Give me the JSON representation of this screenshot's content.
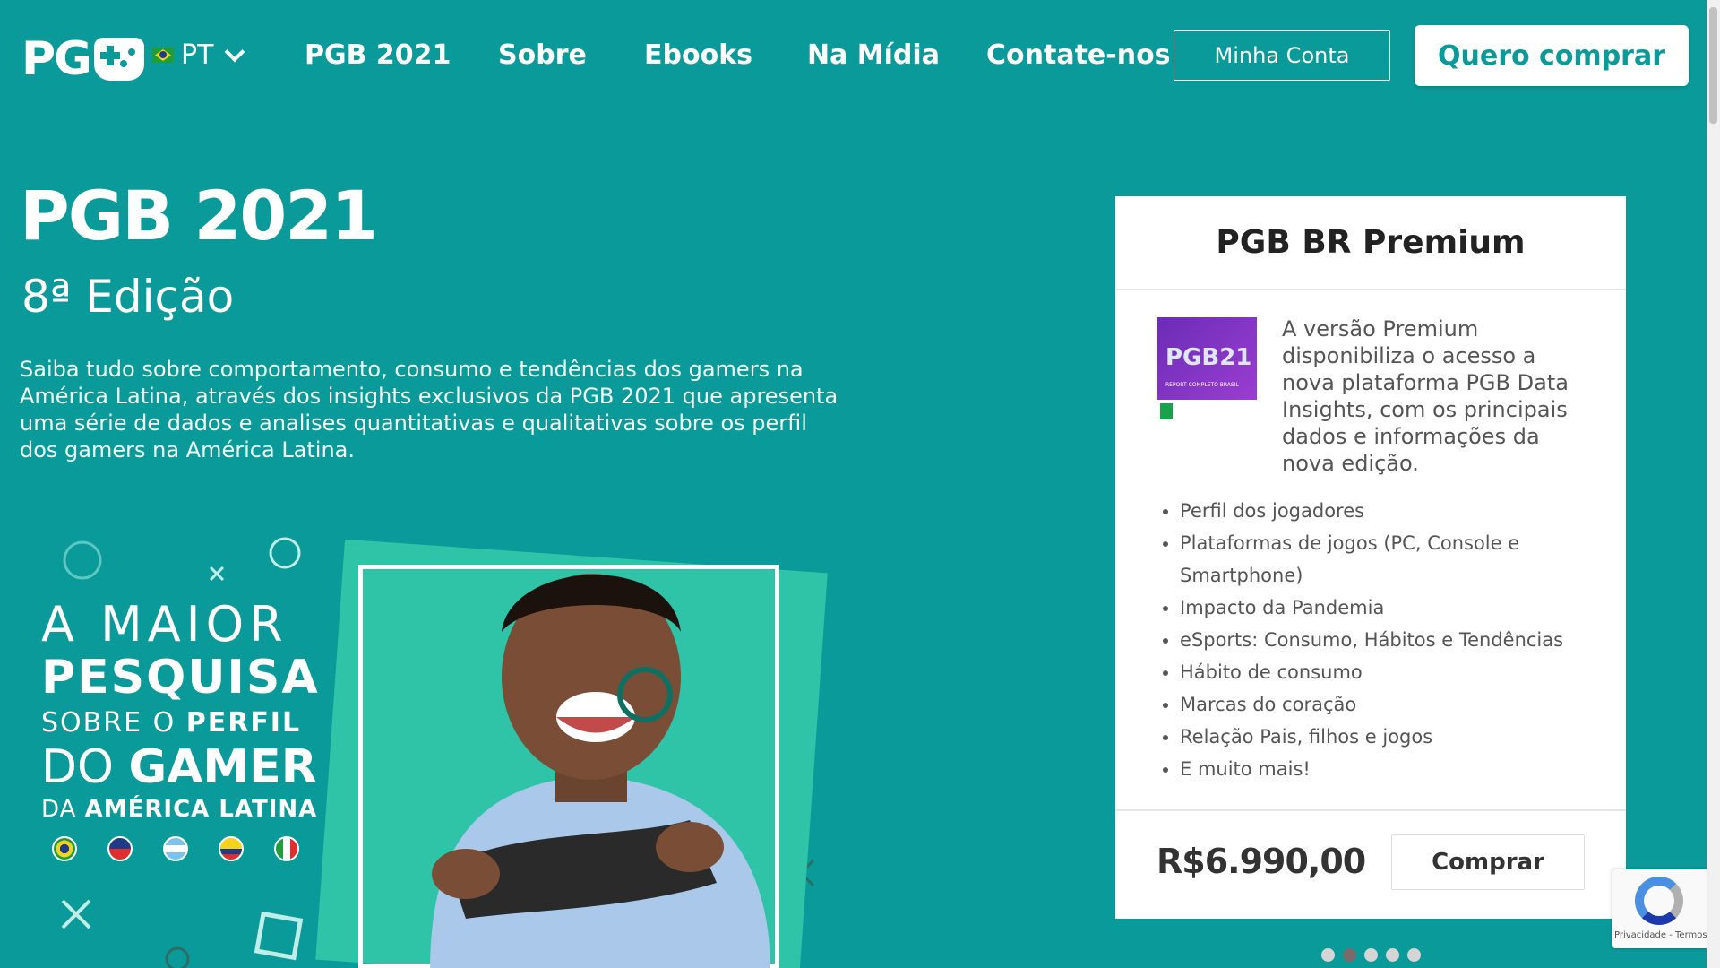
{
  "header": {
    "logo_text": "PG",
    "language": "PT",
    "nav": [
      "PGB 2021",
      "Sobre",
      "Ebooks",
      "Na Mídia",
      "Contate-nos"
    ],
    "account_label": "Minha Conta",
    "buy_label": "Quero comprar"
  },
  "hero": {
    "title": "PGB 2021",
    "subtitle": "8ª Edição",
    "description": "Saiba tudo sobre comportamento, consumo e tendências dos gamers na América Latina, através dos insights exclusivos da PGB 2021 que apresenta uma série de dados e analises quantitativas e qualitativas sobre os perfil dos gamers na América Latina."
  },
  "promo": {
    "line1": "A MAIOR",
    "line2": "PESQUISA",
    "line3a": "SOBRE O ",
    "line3b": "PERFIL",
    "line4a": "DO ",
    "line4b": "GAMER",
    "line5a": "DA ",
    "line5b": "AMÉRICA LATINA",
    "flags": [
      "brazil-flag",
      "chile-flag",
      "argentina-flag",
      "colombia-flag",
      "mexico-flag"
    ]
  },
  "card": {
    "title": "PGB BR Premium",
    "book_label": "PGB21",
    "book_tag": "REPORT COMPLETO BRASIL",
    "intro": "A versão Premium disponibiliza o acesso a nova plataforma PGB Data Insights, com os principais dados e informações da nova edição.",
    "features": [
      "Perfil dos jogadores",
      "Plataformas de jogos (PC, Console e Smartphone)",
      "Impacto da Pandemia",
      "eSports: Consumo, Hábitos e Tendências",
      "Hábito de consumo",
      "Marcas do coração",
      "Relação Pais, filhos e jogos",
      "E muito mais!"
    ],
    "price": "R$6.990,00",
    "buy_label": "Comprar"
  },
  "carousel": {
    "count": 5,
    "active": 2
  },
  "recaptcha": {
    "links": "Privacidade - Termos"
  },
  "colors": {
    "background": "#0b9a9a",
    "accent": "#0b9a9a",
    "card": "#ffffff"
  }
}
